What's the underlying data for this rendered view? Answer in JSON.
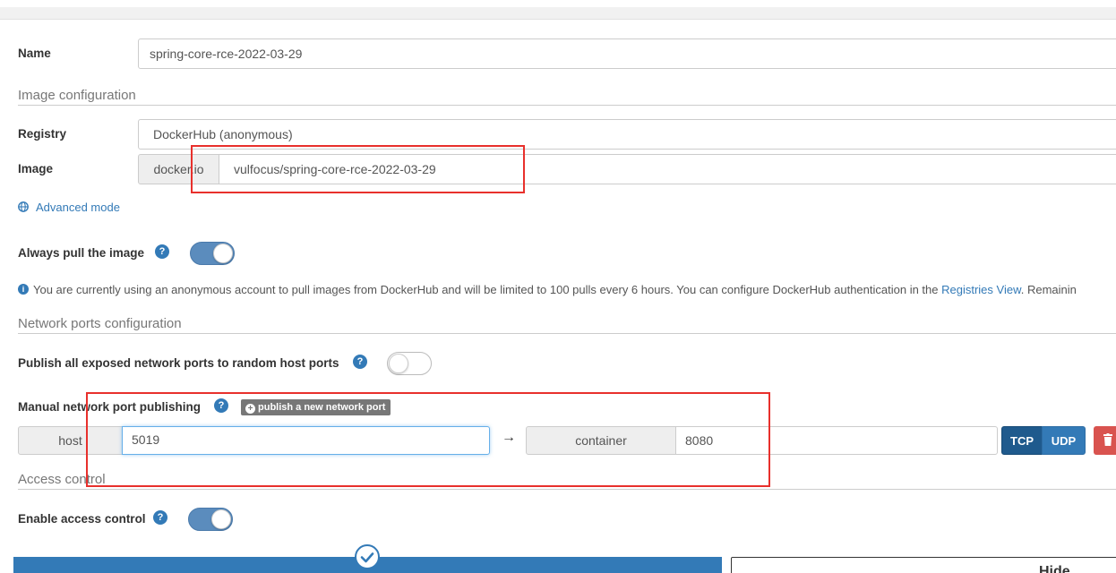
{
  "name_field": {
    "label": "Name",
    "value": "spring-core-rce-2022-03-29"
  },
  "image_config": {
    "section_title": "Image configuration",
    "registry_label": "Registry",
    "registry_value": "DockerHub (anonymous)",
    "image_label": "Image",
    "image_prefix": "docker.io",
    "image_value": "vulfocus/spring-core-rce-2022-03-29",
    "advanced_mode": "Advanced mode"
  },
  "always_pull": {
    "label": "Always pull the image",
    "enabled": true
  },
  "info_message": {
    "text": "You are currently using an anonymous account to pull images from DockerHub and will be limited to 100 pulls every 6 hours. You can configure DockerHub authentication in the ",
    "link": "Registries View",
    "trailing": ". Remainin"
  },
  "network": {
    "section_title": "Network ports configuration",
    "publish_all_label": "Publish all exposed network ports to random host ports",
    "publish_all_enabled": false,
    "manual_label": "Manual network port publishing",
    "publish_button": "publish a new network port",
    "host_addon": "host",
    "host_value": "5019",
    "container_addon": "container",
    "container_value": "8080",
    "protocols": [
      "TCP",
      "UDP"
    ],
    "selected_protocol": "TCP"
  },
  "access": {
    "section_title": "Access control",
    "enable_label": "Enable access control",
    "enabled": true
  },
  "footer": {
    "hide_label": "Hide"
  },
  "colors": {
    "primary": "#337ab7",
    "danger": "#d9534f",
    "highlight": "#e8302c"
  }
}
